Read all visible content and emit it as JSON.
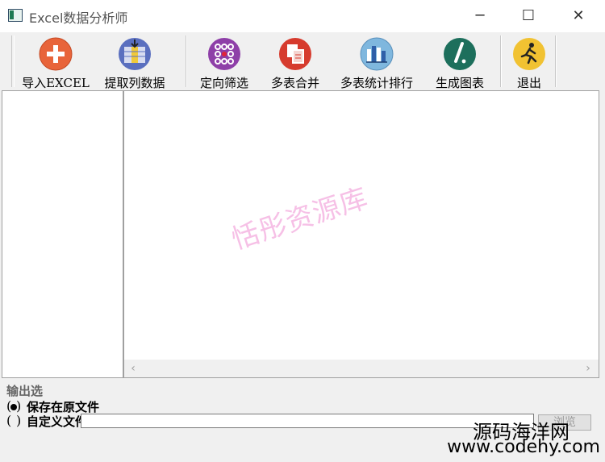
{
  "window": {
    "title": "Excel数据分析师",
    "minimize_glyph": "─",
    "maximize_glyph": "☐",
    "close_glyph": "✕"
  },
  "toolbar": {
    "buttons": [
      {
        "label": "导入EXCEL",
        "icon": "plus-icon",
        "color": "#e8643a"
      },
      {
        "label": "提取列数据",
        "icon": "extract-column-icon",
        "color": "#5a6fbf"
      },
      {
        "label": "定向筛选",
        "icon": "filter-dots-icon",
        "color": "#8e3fa8"
      },
      {
        "label": "多表合并",
        "icon": "merge-tables-icon",
        "color": "#d63b2e"
      },
      {
        "label": "多表统计排行",
        "icon": "bar-ranking-icon",
        "color": "#5aa7d6"
      },
      {
        "label": "生成图表",
        "icon": "chart-pen-icon",
        "color": "#1d6f5c"
      },
      {
        "label": "退出",
        "icon": "running-man-icon",
        "color": "#f1c232"
      }
    ]
  },
  "watermark_text": "恬彤资源库",
  "output": {
    "legend": "输出选",
    "option_save": "保存在原文件",
    "option_custom": "自定义文件",
    "path_value": "",
    "browse_label": "浏览"
  },
  "site_watermark": {
    "line1": "源码海洋网",
    "line2": "www.codehy.com"
  }
}
